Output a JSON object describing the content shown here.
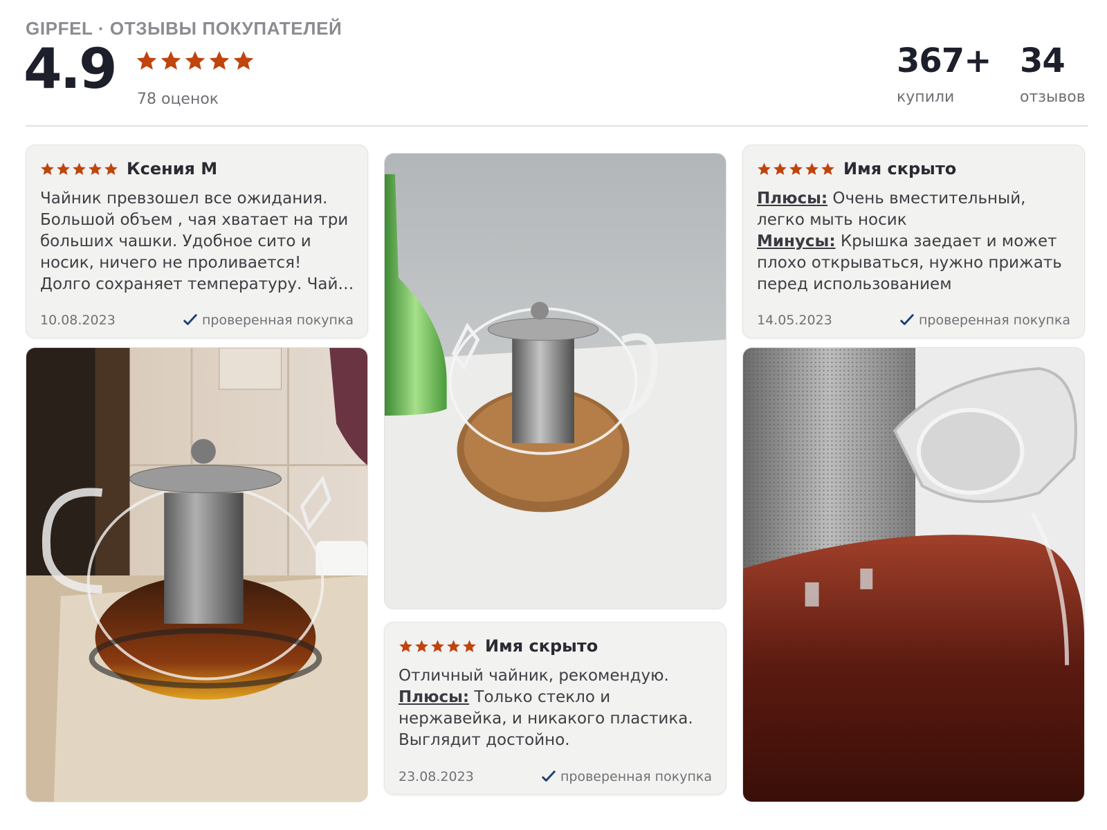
{
  "header": {
    "brand": "GIPFEL · ОТЗЫВЫ ПОКУПАТЕЛЕЙ",
    "rating": "4.9",
    "rating_stars": 5,
    "ratings_count": "78 оценок",
    "bought_value": "367+",
    "bought_label": "купили",
    "reviews_value": "34",
    "reviews_label": "отзывов"
  },
  "colors": {
    "star": "#c0440e",
    "check": "#1f3f73",
    "card_bg": "#f2f2f0"
  },
  "icons": {
    "star": "star-icon",
    "verified": "checkmark-icon"
  },
  "reviews": [
    {
      "stars": 5,
      "author": "Ксения М",
      "text": "Чайник превзошел все ожидания. Большой объем , чая хватает на три больших чашки. Удобное сито и носик, ничего не проливается! Долго сохраняет температуру. Чай пить одно удовольствие!",
      "date": "10.08.2023",
      "verified": "проверенная покупка"
    },
    {
      "stars": 5,
      "author": "Имя скрыто",
      "pros_label": "Плюсы:",
      "pros": " Очень вместительный, легко мыть носик",
      "cons_label": "Минусы:",
      "cons": " Крышка заедает и может плохо открываться, нужно прижать перед использованием",
      "date": "14.05.2023",
      "verified": "проверенная покупка"
    },
    {
      "stars": 5,
      "author": "Имя скрыто",
      "intro": "Отличный чайник, рекомендую.",
      "pros_label": "Плюсы:",
      "pros": " Только стекло и нержавейка, и никакого пластика. Выглядит достойно.",
      "date": "23.08.2023",
      "verified": "проверенная покупка"
    }
  ],
  "photos": [
    {
      "subject": "glass teapot with tea and steel infuser on a counter"
    },
    {
      "subject": "glass teapot on a cork coaster next to a green bottle"
    },
    {
      "subject": "close-up of the teapot spout and infuser with tea"
    }
  ]
}
